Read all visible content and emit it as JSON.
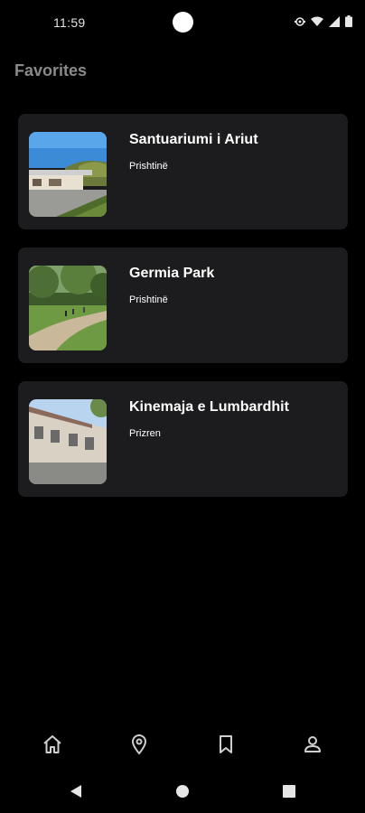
{
  "status_bar": {
    "time": "11:59",
    "icons": [
      "settings-sync-icon",
      "wifi-icon",
      "cellular-signal-icon",
      "battery-icon"
    ]
  },
  "page": {
    "title": "Favorites"
  },
  "favorites": [
    {
      "name": "Santuariumi i Ariut",
      "city": "Prishtinë",
      "thumbnail": "building-with-greenery-photo"
    },
    {
      "name": "Germia Park",
      "city": "Prishtinë",
      "thumbnail": "park-path-photo"
    },
    {
      "name": "Kinemaja e Lumbardhit",
      "city": "Prizren",
      "thumbnail": "cinema-building-photo"
    }
  ],
  "bottom_nav": {
    "items": [
      "home-icon",
      "location-pin-icon",
      "bookmark-icon",
      "person-icon"
    ]
  },
  "system_nav": {
    "items": [
      "back-icon",
      "home-circle-icon",
      "recents-icon"
    ]
  },
  "colors": {
    "background": "#000000",
    "card": "#1c1c1e",
    "title": "#8a8a8a",
    "icon": "#cfcfcf"
  }
}
